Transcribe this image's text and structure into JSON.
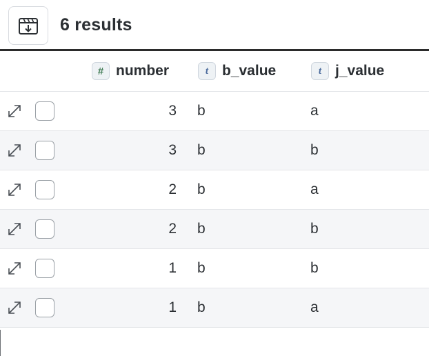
{
  "toolbar": {
    "export_icon": "download-archive-icon",
    "results_label": "6 results"
  },
  "columns": [
    {
      "type_badge": "#",
      "type_name": "number-type-icon",
      "label": "number"
    },
    {
      "type_badge": "t",
      "type_name": "text-type-icon",
      "label": "b_value"
    },
    {
      "type_badge": "t",
      "type_name": "text-type-icon",
      "label": "j_value"
    }
  ],
  "rows": [
    {
      "number": "3",
      "b_value": "b",
      "j_value": "a"
    },
    {
      "number": "3",
      "b_value": "b",
      "j_value": "b"
    },
    {
      "number": "2",
      "b_value": "b",
      "j_value": "a"
    },
    {
      "number": "2",
      "b_value": "b",
      "j_value": "b"
    },
    {
      "number": "1",
      "b_value": "b",
      "j_value": "b"
    },
    {
      "number": "1",
      "b_value": "b",
      "j_value": "a"
    }
  ],
  "colors": {
    "alt_row": "#f5f6f8",
    "border": "#e3e5e8",
    "number_badge": "#3f7a53",
    "text_badge": "#4a6a9c"
  }
}
